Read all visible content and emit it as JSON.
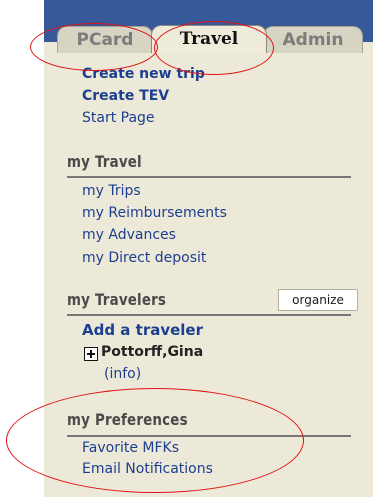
{
  "tabs": [
    {
      "label": "PCard",
      "state": "inactive"
    },
    {
      "label": "Travel",
      "state": "active"
    },
    {
      "label": "Admin",
      "state": "inactive"
    }
  ],
  "top_links": [
    "Create new trip",
    "Create TEV",
    "Start Page"
  ],
  "my_travel": {
    "title": "my Travel",
    "links": [
      "my Trips",
      "my Reimbursements",
      "my Advances",
      "my Direct deposit"
    ]
  },
  "my_travelers": {
    "title": "my Travelers",
    "organize_label": "organize",
    "add_label": "Add a traveler",
    "traveler": {
      "name": "Pottorff,Gina",
      "info_label": "(info)",
      "expand_icon": "plus-box-icon"
    }
  },
  "my_preferences": {
    "title": "my Preferences",
    "links": [
      "Favorite MFKs",
      "Email Notifications"
    ]
  },
  "colors": {
    "header_blue": "#37599a",
    "panel_beige": "#ede9d8",
    "link_blue": "#1c3f8f",
    "annotation_red": "#e11111"
  }
}
